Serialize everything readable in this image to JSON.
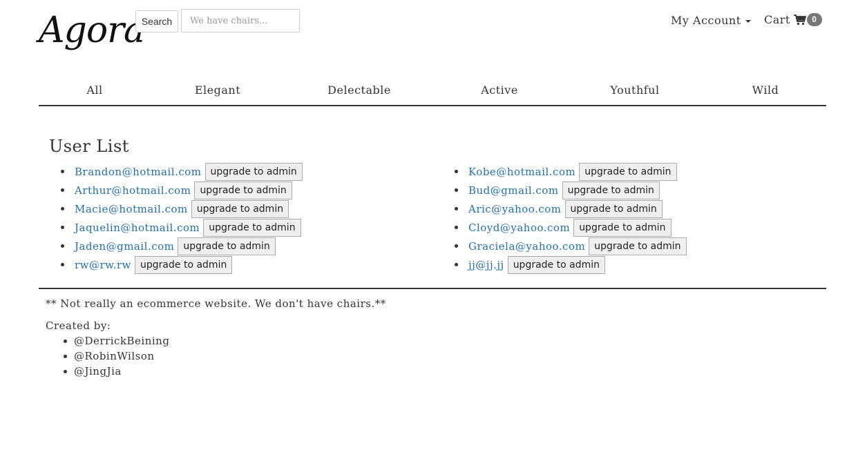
{
  "header": {
    "logo_text": "Agora",
    "search_button": "Search",
    "search_placeholder": "We have chairs...",
    "account_label": "My Account",
    "cart_label": "Cart",
    "cart_count": "0"
  },
  "categories": [
    "All",
    "Elegant",
    "Delectable",
    "Active",
    "Youthful",
    "Wild"
  ],
  "user_list": {
    "title": "User List",
    "upgrade_label": "upgrade to admin",
    "left": [
      "Brandon@hotmail.com",
      "Arthur@hotmail.com",
      "Macie@hotmail.com",
      "Jaquelin@hotmail.com",
      "Jaden@gmail.com",
      "rw@rw.rw"
    ],
    "right": [
      "Kobe@hotmail.com",
      "Bud@gmail.com",
      "Aric@yahoo.com",
      "Cloyd@yahoo.com",
      "Graciela@yahoo.com",
      "jj@jj.jj"
    ]
  },
  "footer": {
    "note": "** Not really an ecommerce website. We don't have chairs.**",
    "created_by": "Created by:",
    "credits": [
      "@DerrickBeining",
      "@RobinWilson",
      "@JingJia"
    ]
  },
  "colors": {
    "link": "#1f6fb2",
    "text": "#333333",
    "badge": "#777777"
  },
  "icons": [
    "shopping-cart-icon",
    "caret-down-icon"
  ]
}
